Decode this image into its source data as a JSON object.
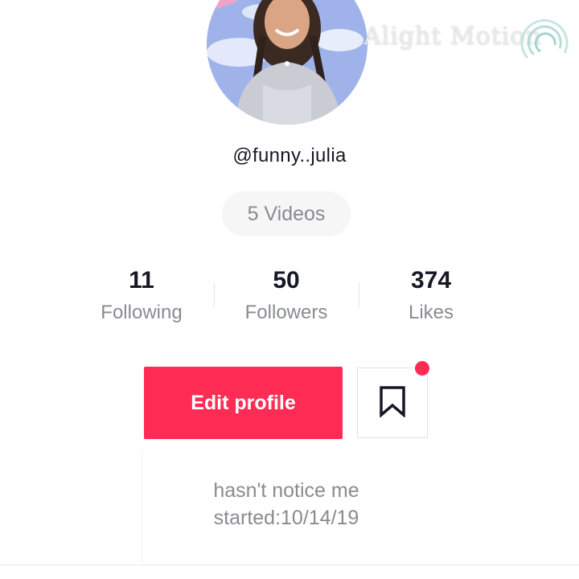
{
  "profile": {
    "username": "@funny..julia",
    "videos_label": "5 Videos"
  },
  "watermark": {
    "text": "Alight Motion"
  },
  "stats": {
    "following": {
      "count": "11",
      "label": "Following"
    },
    "followers": {
      "count": "50",
      "label": "Followers"
    },
    "likes": {
      "count": "374",
      "label": "Likes"
    }
  },
  "actions": {
    "edit_profile_label": "Edit profile",
    "bookmark_icon": "bookmark-icon",
    "has_notification": true
  },
  "bio": {
    "line1": "hasn't notice me",
    "line2": "started:10/14/19"
  },
  "colors": {
    "accent": "#fe2c55",
    "text_primary": "#161823",
    "text_secondary": "#8a8b91"
  }
}
